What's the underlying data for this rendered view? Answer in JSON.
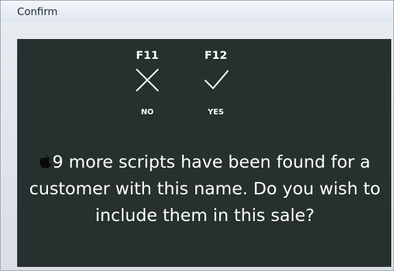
{
  "window": {
    "title": "Confirm"
  },
  "actions": [
    {
      "key": "F11",
      "icon": "x-icon",
      "label": "NO"
    },
    {
      "key": "F12",
      "icon": "checkmark-icon",
      "label": "YES"
    }
  ],
  "message": {
    "icon": "apple-icon",
    "text": "9 more scripts have been found for a customer with this name. Do you wish to include them in this sale?"
  },
  "colors": {
    "panel_background": "#26302f",
    "text": "#ffffff",
    "titlebar": "#e6ebf1"
  }
}
